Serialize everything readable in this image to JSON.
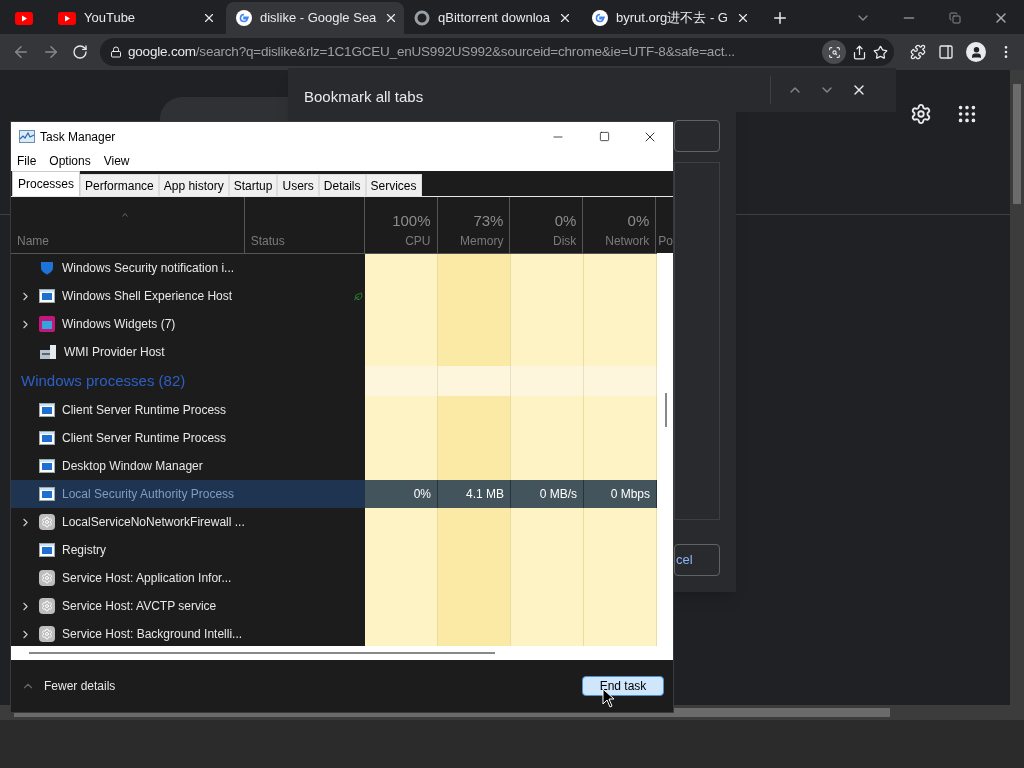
{
  "browser": {
    "tabs": [
      {
        "kind": "youtube",
        "selected": false
      },
      {
        "kind": "youtube",
        "title": "YouTube",
        "selected": false
      },
      {
        "kind": "google",
        "title": "dislike - Google Sea",
        "selected": true
      },
      {
        "kind": "ring",
        "title": "qBittorrent downloa",
        "selected": false
      },
      {
        "kind": "google",
        "title": "byrut.org进不去 - G",
        "selected": false
      }
    ],
    "address_host": "google.com",
    "address_path": "/search?q=dislike&rlz=1C1GCEU_enUS992US992&sourceid=chrome&ie=UTF-8&safe=act...",
    "bookmark_dialog": {
      "title": "Bookmark all tabs",
      "button": "cel"
    }
  },
  "task_manager": {
    "title": "Task Manager",
    "menu": [
      "File",
      "Options",
      "View"
    ],
    "tabs": [
      {
        "label": "Processes",
        "selected": true
      },
      {
        "label": "Performance",
        "selected": false
      },
      {
        "label": "App history",
        "selected": false
      },
      {
        "label": "Startup",
        "selected": false
      },
      {
        "label": "Users",
        "selected": false
      },
      {
        "label": "Details",
        "selected": false
      },
      {
        "label": "Services",
        "selected": false
      }
    ],
    "columns": [
      {
        "label": "Name"
      },
      {
        "label": "Status"
      },
      {
        "label": "CPU",
        "usage": "100%"
      },
      {
        "label": "Memory",
        "usage": "73%"
      },
      {
        "label": "Disk",
        "usage": "0%"
      },
      {
        "label": "Network",
        "usage": "0%"
      },
      {
        "label": "Po"
      }
    ],
    "rows": [
      {
        "kind": "shield",
        "name": "Windows Security notification i...",
        "expandable": false,
        "suspended": false,
        "selected": false
      },
      {
        "kind": "window",
        "name": "Windows Shell Experience Host",
        "expandable": true,
        "suspended": true,
        "selected": false
      },
      {
        "kind": "widgets",
        "name": "Windows Widgets (7)",
        "expandable": true,
        "suspended": false,
        "selected": false
      },
      {
        "kind": "server",
        "name": "WMI Provider Host",
        "expandable": false,
        "suspended": false,
        "selected": false
      },
      {
        "kind": "group",
        "name": "Windows processes (82)"
      },
      {
        "kind": "window",
        "name": "Client Server Runtime Process",
        "expandable": false,
        "suspended": false,
        "selected": false
      },
      {
        "kind": "window",
        "name": "Client Server Runtime Process",
        "expandable": false,
        "suspended": false,
        "selected": false
      },
      {
        "kind": "window",
        "name": "Desktop Window Manager",
        "expandable": false,
        "suspended": false,
        "selected": false
      },
      {
        "kind": "window",
        "name": "Local Security Authority Process",
        "expandable": false,
        "suspended": false,
        "selected": true,
        "values": [
          "0%",
          "4.1 MB",
          "0 MB/s",
          "0 Mbps"
        ]
      },
      {
        "kind": "gear",
        "name": "LocalServiceNoNetworkFirewall ...",
        "expandable": true,
        "suspended": false,
        "selected": false
      },
      {
        "kind": "window",
        "name": "Registry",
        "expandable": false,
        "suspended": false,
        "selected": false
      },
      {
        "kind": "gear",
        "name": "Service Host: Application Infor...",
        "expandable": false,
        "suspended": false,
        "selected": false
      },
      {
        "kind": "gear",
        "name": "Service Host: AVCTP service",
        "expandable": true,
        "suspended": false,
        "selected": false
      },
      {
        "kind": "gear",
        "name": "Service Host: Background Intelli...",
        "expandable": true,
        "suspended": false,
        "selected": false
      }
    ],
    "fewer_details": "Fewer details",
    "end_task": "End task"
  }
}
